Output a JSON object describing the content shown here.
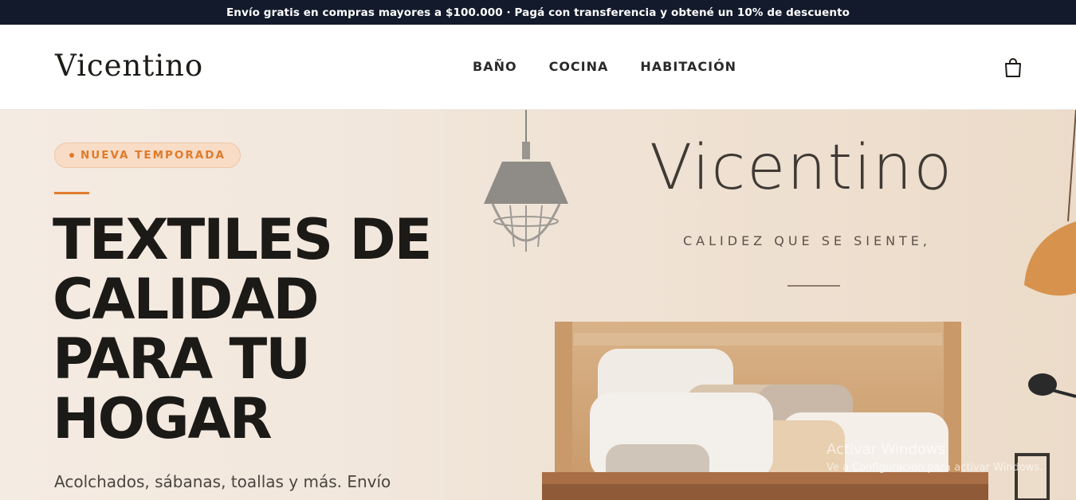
{
  "announcement": "Envío gratis en compras mayores a $100.000 · Pagá con transferencia y obtené un 10% de descuento",
  "header": {
    "logo": "Vicentino",
    "nav": [
      "BAÑO",
      "COCINA",
      "HABITACIÓN"
    ],
    "cart_icon": "shopping-bag-icon"
  },
  "hero": {
    "badge": "NUEVA TEMPORADA",
    "headline": [
      "TEXTILES DE",
      "CALIDAD",
      "PARA TU",
      "HOGAR"
    ],
    "subtext": "Acolchados, sábanas, toallas y más. Envío",
    "image_brand": "Vicentino",
    "image_tagline": "CALIDEZ QUE SE SIENTE,"
  },
  "overlay": {
    "activate_title": "Activar Windows",
    "activate_text": "Ve a Configuración para activar Windows."
  },
  "colors": {
    "accent": "#e07b2b",
    "topbar": "#121a2b",
    "text": "#1c1a17"
  }
}
